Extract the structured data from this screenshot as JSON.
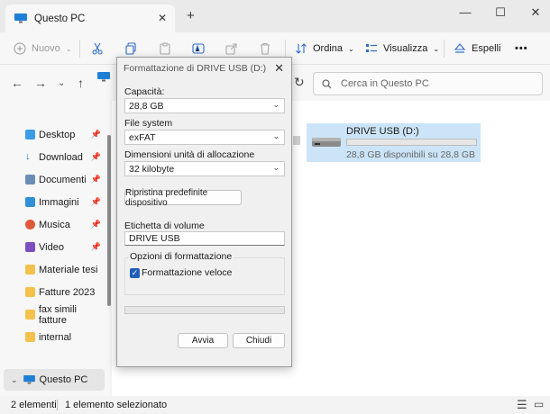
{
  "titlebar": {
    "tab_title": "Questo PC",
    "close_tab": "✕",
    "new_tab": "+",
    "minimize": "—",
    "maximize": "☐",
    "close": "✕"
  },
  "toolbar": {
    "new_label": "Nuovo",
    "sort_label": "Ordina",
    "view_label": "Visualizza",
    "eject_label": "Espelli",
    "more_label": "•••"
  },
  "address": {
    "search_placeholder": "Cerca in Questo PC"
  },
  "sidebar": {
    "items": [
      {
        "label": "Desktop",
        "icon": "desktop-icon",
        "pinned": true
      },
      {
        "label": "Download",
        "icon": "download-icon",
        "pinned": true
      },
      {
        "label": "Documenti",
        "icon": "documents-icon",
        "pinned": true
      },
      {
        "label": "Immagini",
        "icon": "pictures-icon",
        "pinned": true
      },
      {
        "label": "Musica",
        "icon": "music-icon",
        "pinned": true
      },
      {
        "label": "Video",
        "icon": "video-icon",
        "pinned": true
      },
      {
        "label": "Materiale tesi",
        "icon": "folder-icon",
        "pinned": false
      },
      {
        "label": "Fatture 2023",
        "icon": "folder-icon",
        "pinned": false
      },
      {
        "label": "fax simili fatture",
        "icon": "folder-icon",
        "pinned": false
      },
      {
        "label": "internal",
        "icon": "folder-icon",
        "pinned": false
      }
    ],
    "selected": "Questo PC"
  },
  "drive": {
    "name": "DRIVE USB (D:)",
    "free_text": "28,8 GB disponibili su 28,8 GB",
    "used_fraction": 0.0
  },
  "statusbar": {
    "count": "2 elementi",
    "selected": "1 elemento selezionato"
  },
  "dialog": {
    "title": "Formattazione di DRIVE USB (D:)",
    "close": "✕",
    "capacity_label": "Capacità:",
    "capacity_value": "28,8 GB",
    "fs_label": "File system",
    "fs_value": "exFAT",
    "alloc_label": "Dimensioni unità di allocazione",
    "alloc_value": "32 kilobyte",
    "restore_button": "Ripristina predefinite dispositivo",
    "volume_label": "Etichetta di volume",
    "volume_value": "DRIVE USB",
    "options_title": "Opzioni di formattazione",
    "quick_format": "Formattazione veloce",
    "quick_format_checked": true,
    "progress": 0.0,
    "start_button": "Avvia",
    "close_button": "Chiudi"
  },
  "colors": {
    "accent": "#1f5fb8",
    "selection": "#cce4f7"
  }
}
